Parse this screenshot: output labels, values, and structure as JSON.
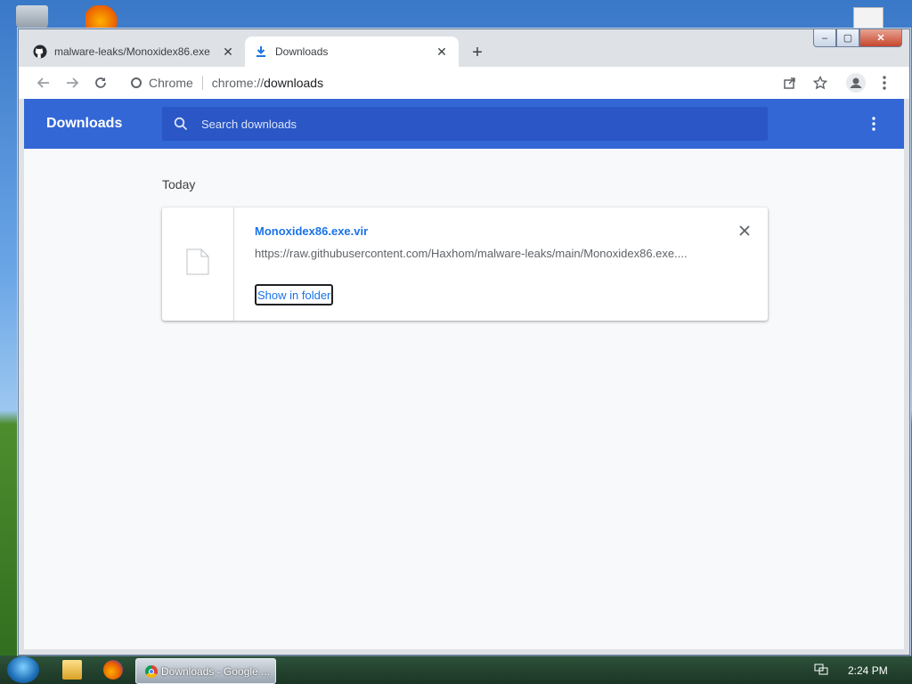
{
  "window": {
    "tabs": [
      {
        "label": "malware-leaks/Monoxidex86.exe",
        "icon": "github-icon",
        "active": false
      },
      {
        "label": "Downloads",
        "icon": "download-icon",
        "active": true
      }
    ],
    "new_tab_label": "+",
    "controls": {
      "minimize": "–",
      "maximize": "▢",
      "close": "✕"
    }
  },
  "toolbar": {
    "site_chip_label": "Chrome",
    "url_prefix": "chrome://",
    "url_path": "downloads"
  },
  "downloads_page": {
    "title": "Downloads",
    "search_placeholder": "Search downloads",
    "section_label": "Today",
    "items": [
      {
        "file_name": "Monoxidex86.exe.vir",
        "url": "https://raw.githubusercontent.com/Haxhom/malware-leaks/main/Monoxidex86.exe....",
        "action_label": "Show in folder"
      }
    ]
  },
  "taskbar": {
    "task_label": "Downloads - Google ...",
    "clock": "2:24 PM"
  },
  "colors": {
    "header_blue": "#3367d6",
    "search_blue": "#2a56c6",
    "link_blue": "#1a73e8"
  }
}
